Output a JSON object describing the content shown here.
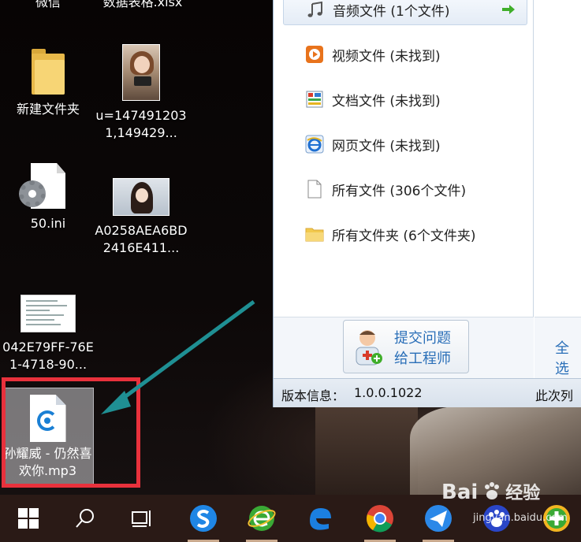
{
  "desktop": {
    "top_labels": [
      "微信",
      "数据表格.xlsx"
    ],
    "icons": [
      {
        "label": "新建文件夹",
        "kind": "folder"
      },
      {
        "label": "u=1474912031,149429...",
        "kind": "photo"
      },
      {
        "label": "50.ini",
        "kind": "ini-file"
      },
      {
        "label": "A0258AEA6BD2416E411...",
        "kind": "photo"
      },
      {
        "label": "042E79FF-76E1-4718-90...",
        "kind": "document-thumbnail"
      }
    ],
    "selected_icon": {
      "label": "孙耀威 - 仍然喜欢你.mp3",
      "kind": "mp3-file"
    }
  },
  "window": {
    "categories": [
      {
        "label": "音频文件 (1个文件)",
        "icon": "music-note-icon",
        "active": true
      },
      {
        "label": "视频文件 (未找到)",
        "icon": "video-play-icon",
        "active": false
      },
      {
        "label": "文档文件 (未找到)",
        "icon": "document-icon",
        "active": false
      },
      {
        "label": "网页文件 (未找到)",
        "icon": "ie-browser-icon",
        "active": false
      },
      {
        "label": "所有文件 (306个文件)",
        "icon": "blank-file-icon",
        "active": false
      },
      {
        "label": "所有文件夹 (6个文件夹)",
        "icon": "folder-icon",
        "active": false
      }
    ],
    "help_button": {
      "line1": "提交问题",
      "line2": "给工程师"
    },
    "select_all": "全选",
    "status": {
      "version_label": "版本信息：",
      "version": "1.0.0.1022",
      "scan_text": "此次列"
    }
  },
  "taskbar": {
    "items": [
      "start-button",
      "search-button",
      "task-view-button",
      "sogou-browser",
      "360-browser",
      "edge-browser",
      "chrome-browser",
      "feishu-app",
      "baidu-app",
      "360-guard"
    ]
  },
  "watermark": {
    "brand": "Bai",
    "brand_cn": "经验",
    "site": "jingyan.baidu.com"
  },
  "colors": {
    "accent": "#2a6fb8",
    "highlight_red": "#e8313c",
    "arrow_teal": "#1f8f93",
    "taskbar": "#2a1a16"
  }
}
